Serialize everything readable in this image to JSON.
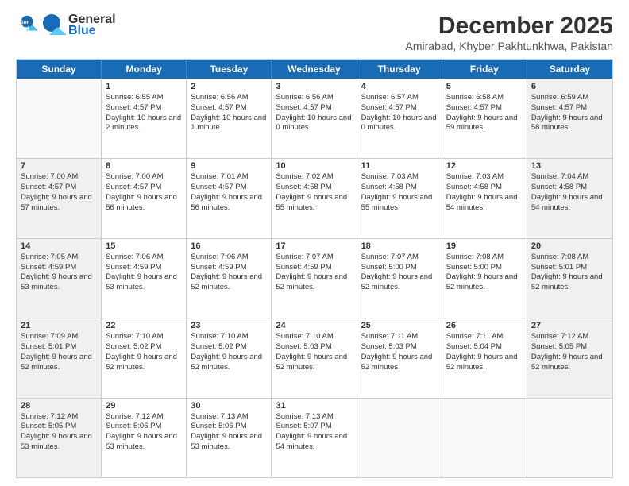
{
  "logo": {
    "line1": "General",
    "line2": "Blue"
  },
  "title": "December 2025",
  "location": "Amirabad, Khyber Pakhtunkhwa, Pakistan",
  "days": [
    "Sunday",
    "Monday",
    "Tuesday",
    "Wednesday",
    "Thursday",
    "Friday",
    "Saturday"
  ],
  "rows": [
    [
      {
        "num": "",
        "rise": "",
        "set": "",
        "day": "",
        "empty": true
      },
      {
        "num": "1",
        "rise": "Sunrise: 6:55 AM",
        "set": "Sunset: 4:57 PM",
        "day": "Daylight: 10 hours and 2 minutes."
      },
      {
        "num": "2",
        "rise": "Sunrise: 6:56 AM",
        "set": "Sunset: 4:57 PM",
        "day": "Daylight: 10 hours and 1 minute."
      },
      {
        "num": "3",
        "rise": "Sunrise: 6:56 AM",
        "set": "Sunset: 4:57 PM",
        "day": "Daylight: 10 hours and 0 minutes."
      },
      {
        "num": "4",
        "rise": "Sunrise: 6:57 AM",
        "set": "Sunset: 4:57 PM",
        "day": "Daylight: 10 hours and 0 minutes."
      },
      {
        "num": "5",
        "rise": "Sunrise: 6:58 AM",
        "set": "Sunset: 4:57 PM",
        "day": "Daylight: 9 hours and 59 minutes."
      },
      {
        "num": "6",
        "rise": "Sunrise: 6:59 AM",
        "set": "Sunset: 4:57 PM",
        "day": "Daylight: 9 hours and 58 minutes."
      }
    ],
    [
      {
        "num": "7",
        "rise": "Sunrise: 7:00 AM",
        "set": "Sunset: 4:57 PM",
        "day": "Daylight: 9 hours and 57 minutes."
      },
      {
        "num": "8",
        "rise": "Sunrise: 7:00 AM",
        "set": "Sunset: 4:57 PM",
        "day": "Daylight: 9 hours and 56 minutes."
      },
      {
        "num": "9",
        "rise": "Sunrise: 7:01 AM",
        "set": "Sunset: 4:57 PM",
        "day": "Daylight: 9 hours and 56 minutes."
      },
      {
        "num": "10",
        "rise": "Sunrise: 7:02 AM",
        "set": "Sunset: 4:58 PM",
        "day": "Daylight: 9 hours and 55 minutes."
      },
      {
        "num": "11",
        "rise": "Sunrise: 7:03 AM",
        "set": "Sunset: 4:58 PM",
        "day": "Daylight: 9 hours and 55 minutes."
      },
      {
        "num": "12",
        "rise": "Sunrise: 7:03 AM",
        "set": "Sunset: 4:58 PM",
        "day": "Daylight: 9 hours and 54 minutes."
      },
      {
        "num": "13",
        "rise": "Sunrise: 7:04 AM",
        "set": "Sunset: 4:58 PM",
        "day": "Daylight: 9 hours and 54 minutes."
      }
    ],
    [
      {
        "num": "14",
        "rise": "Sunrise: 7:05 AM",
        "set": "Sunset: 4:59 PM",
        "day": "Daylight: 9 hours and 53 minutes."
      },
      {
        "num": "15",
        "rise": "Sunrise: 7:06 AM",
        "set": "Sunset: 4:59 PM",
        "day": "Daylight: 9 hours and 53 minutes."
      },
      {
        "num": "16",
        "rise": "Sunrise: 7:06 AM",
        "set": "Sunset: 4:59 PM",
        "day": "Daylight: 9 hours and 52 minutes."
      },
      {
        "num": "17",
        "rise": "Sunrise: 7:07 AM",
        "set": "Sunset: 4:59 PM",
        "day": "Daylight: 9 hours and 52 minutes."
      },
      {
        "num": "18",
        "rise": "Sunrise: 7:07 AM",
        "set": "Sunset: 5:00 PM",
        "day": "Daylight: 9 hours and 52 minutes."
      },
      {
        "num": "19",
        "rise": "Sunrise: 7:08 AM",
        "set": "Sunset: 5:00 PM",
        "day": "Daylight: 9 hours and 52 minutes."
      },
      {
        "num": "20",
        "rise": "Sunrise: 7:08 AM",
        "set": "Sunset: 5:01 PM",
        "day": "Daylight: 9 hours and 52 minutes."
      }
    ],
    [
      {
        "num": "21",
        "rise": "Sunrise: 7:09 AM",
        "set": "Sunset: 5:01 PM",
        "day": "Daylight: 9 hours and 52 minutes."
      },
      {
        "num": "22",
        "rise": "Sunrise: 7:10 AM",
        "set": "Sunset: 5:02 PM",
        "day": "Daylight: 9 hours and 52 minutes."
      },
      {
        "num": "23",
        "rise": "Sunrise: 7:10 AM",
        "set": "Sunset: 5:02 PM",
        "day": "Daylight: 9 hours and 52 minutes."
      },
      {
        "num": "24",
        "rise": "Sunrise: 7:10 AM",
        "set": "Sunset: 5:03 PM",
        "day": "Daylight: 9 hours and 52 minutes."
      },
      {
        "num": "25",
        "rise": "Sunrise: 7:11 AM",
        "set": "Sunset: 5:03 PM",
        "day": "Daylight: 9 hours and 52 minutes."
      },
      {
        "num": "26",
        "rise": "Sunrise: 7:11 AM",
        "set": "Sunset: 5:04 PM",
        "day": "Daylight: 9 hours and 52 minutes."
      },
      {
        "num": "27",
        "rise": "Sunrise: 7:12 AM",
        "set": "Sunset: 5:05 PM",
        "day": "Daylight: 9 hours and 52 minutes."
      }
    ],
    [
      {
        "num": "28",
        "rise": "Sunrise: 7:12 AM",
        "set": "Sunset: 5:05 PM",
        "day": "Daylight: 9 hours and 53 minutes."
      },
      {
        "num": "29",
        "rise": "Sunrise: 7:12 AM",
        "set": "Sunset: 5:06 PM",
        "day": "Daylight: 9 hours and 53 minutes."
      },
      {
        "num": "30",
        "rise": "Sunrise: 7:13 AM",
        "set": "Sunset: 5:06 PM",
        "day": "Daylight: 9 hours and 53 minutes."
      },
      {
        "num": "31",
        "rise": "Sunrise: 7:13 AM",
        "set": "Sunset: 5:07 PM",
        "day": "Daylight: 9 hours and 54 minutes."
      },
      {
        "num": "",
        "rise": "",
        "set": "",
        "day": "",
        "empty": true
      },
      {
        "num": "",
        "rise": "",
        "set": "",
        "day": "",
        "empty": true
      },
      {
        "num": "",
        "rise": "",
        "set": "",
        "day": "",
        "empty": true
      }
    ]
  ]
}
